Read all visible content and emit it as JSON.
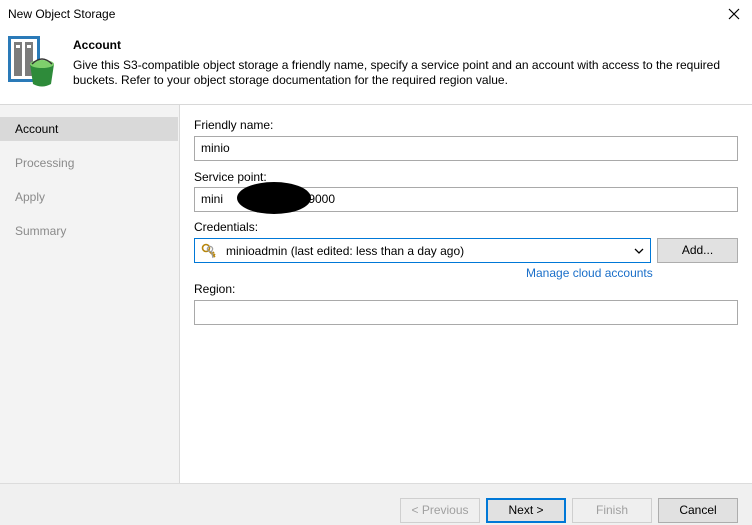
{
  "window": {
    "title": "New Object Storage"
  },
  "header": {
    "title": "Account",
    "description": "Give this S3-compatible object storage a friendly name, specify a service point and an account with access to the required buckets. Refer to your object storage documentation for the required region value."
  },
  "sidebar": {
    "items": [
      {
        "label": "Account",
        "active": true
      },
      {
        "label": "Processing",
        "active": false
      },
      {
        "label": "Apply",
        "active": false
      },
      {
        "label": "Summary",
        "active": false
      }
    ]
  },
  "form": {
    "friendly_name_label": "Friendly name:",
    "friendly_name_value": "minio",
    "service_point_label": "Service point:",
    "service_point_prefix": "mini",
    "service_point_suffix": ":9000",
    "credentials_label": "Credentials:",
    "credentials_value": "minioadmin (last edited: less than a day ago)",
    "add_button": "Add...",
    "manage_link": "Manage cloud accounts",
    "region_label": "Region:",
    "region_value": ""
  },
  "footer": {
    "previous": "< Previous",
    "next": "Next >",
    "finish": "Finish",
    "cancel": "Cancel"
  },
  "colors": {
    "accent": "#0078d7",
    "link": "#1a6fc9",
    "sidebar_bg": "#f3f3f3",
    "footer_bg": "#f0f0f0"
  },
  "icons": {
    "header": "object-storage-bucket-icon",
    "close": "close-icon",
    "credentials": "key-icon",
    "dropdown": "chevron-down-icon"
  }
}
